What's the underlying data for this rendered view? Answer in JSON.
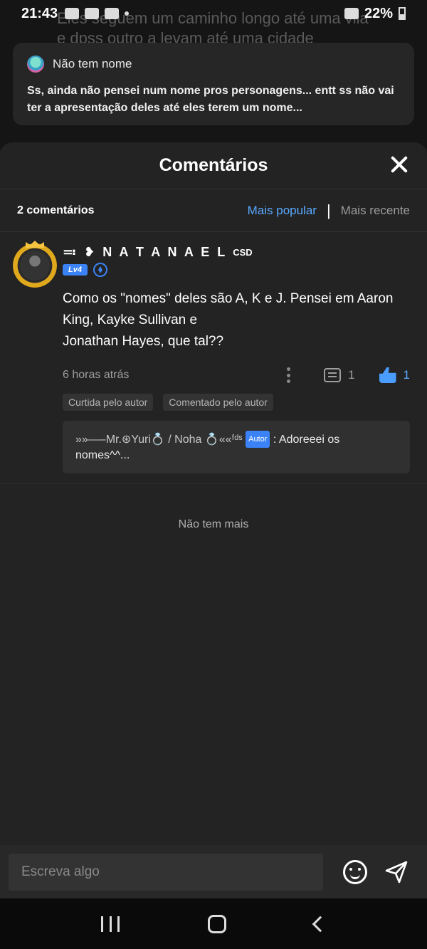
{
  "status_bar": {
    "time": "21:43",
    "battery": "22%"
  },
  "background": {
    "story_text": "Eles seguem um caminho longo até uma vila e dpss outro a levam até uma cidade",
    "card_author": "Não tem nome",
    "card_text": "Ss, ainda não pensei num nome pros personagens... entt ss não vai ter a apresentação deles até eles terem um nome..."
  },
  "sheet": {
    "title": "Comentários",
    "count": "2 comentários",
    "sort_popular": "Mais popular",
    "sort_separator": "|",
    "sort_recent": "Mais recente"
  },
  "comment": {
    "author": "≕ ❥ N A T A N A E L",
    "author_tag": "CSD",
    "level": "Lv4",
    "text": "Como os \"nomes\" deles são A, K e J. Pensei em Aaron King, Kayke Sullivan e\nJonathan Hayes, que tal??",
    "time": "6 horas atrás",
    "reply_count": "1",
    "like_count": "1",
    "tag_liked": "Curtida pelo autor",
    "tag_commented": "Comentado pelo autor",
    "reply": {
      "name": "»»—–Mr.⊛Yuri💍 / Noha 💍««ᶠᵈˢ",
      "badge": "Autor",
      "text": ": Adoreeei os nomes^^..."
    }
  },
  "end_text": "Não tem mais",
  "input": {
    "placeholder": "Escreva algo"
  },
  "colors": {
    "accent": "#5aa9ff",
    "badge": "#3b82f6",
    "sheet_bg": "#232323"
  }
}
